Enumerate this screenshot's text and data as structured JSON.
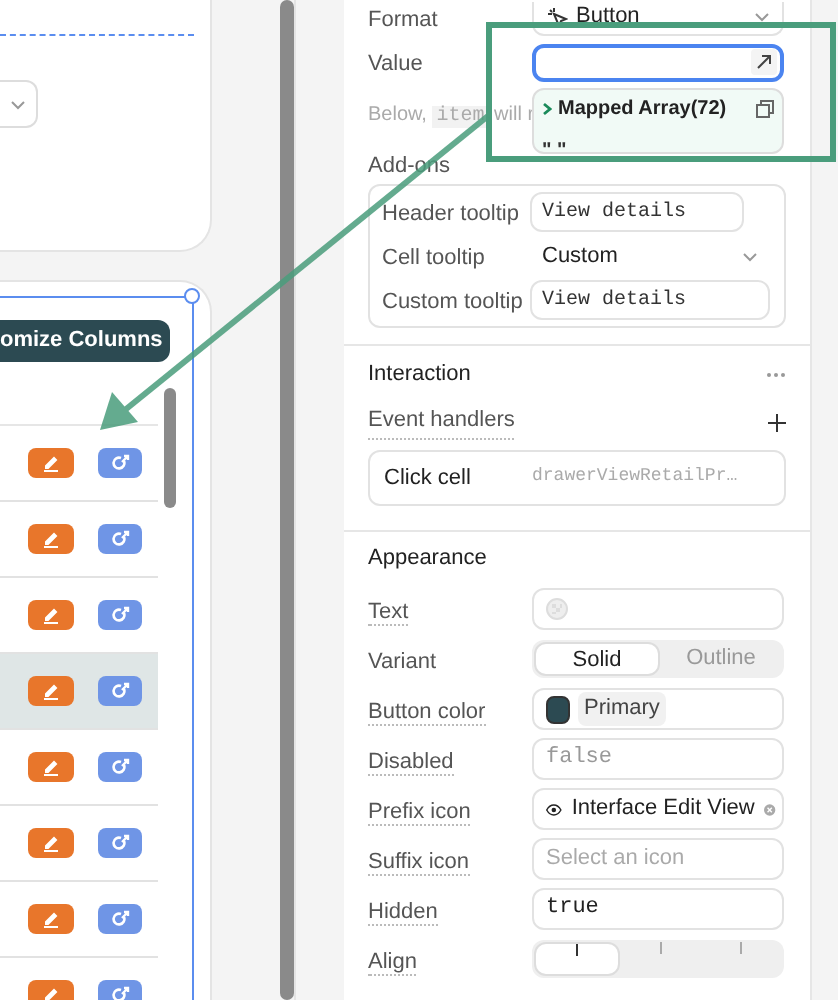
{
  "canvas": {
    "table": {
      "toolbar_button": "omize Columns",
      "rows": [
        {
          "selected": false
        },
        {
          "selected": false
        },
        {
          "selected": false
        },
        {
          "selected": true
        },
        {
          "selected": false
        },
        {
          "selected": false
        },
        {
          "selected": false
        },
        {
          "selected": false
        }
      ]
    }
  },
  "inspector": {
    "format": {
      "label": "Format",
      "value": "Button"
    },
    "value": {
      "label": "Value",
      "focused": true
    },
    "helper": {
      "before": "Below,",
      "code": "item",
      "after": "will r"
    },
    "mapped_array": {
      "title": "Mapped Array(72)",
      "preview": "\" \""
    },
    "addons": {
      "label": "Add-ons",
      "rows": [
        {
          "kind": "input",
          "label": "Header tooltip",
          "value": "View details"
        },
        {
          "kind": "select",
          "label": "Cell tooltip",
          "value": "Custom"
        },
        {
          "kind": "input",
          "label": "Custom tooltip",
          "value": "View details"
        }
      ]
    },
    "interaction": {
      "title": "Interaction",
      "event_handlers": "Event handlers",
      "handlers": [
        {
          "event": "Click cell",
          "action": "drawerViewRetailPr…"
        }
      ]
    },
    "appearance": {
      "title": "Appearance",
      "fields": [
        {
          "kind": "icon_input",
          "label": "Text"
        },
        {
          "kind": "segmented",
          "label": "Variant",
          "options": [
            {
              "label": "Solid",
              "selected": true
            },
            {
              "label": "Outline",
              "selected": false
            }
          ]
        },
        {
          "kind": "color",
          "label": "Button color",
          "value": "Primary",
          "color": "#2c4a52"
        },
        {
          "kind": "code",
          "label": "Disabled",
          "placeholder": "false"
        },
        {
          "kind": "icon_select",
          "label": "Prefix icon",
          "value": "Interface Edit View"
        },
        {
          "kind": "select",
          "label": "Suffix icon",
          "placeholder": "Select an icon"
        },
        {
          "kind": "code",
          "label": "Hidden",
          "value": "true"
        },
        {
          "kind": "align",
          "label": "Align",
          "options": [
            {
              "selected": true
            },
            {
              "selected": false
            },
            {
              "selected": false
            }
          ]
        }
      ]
    }
  }
}
